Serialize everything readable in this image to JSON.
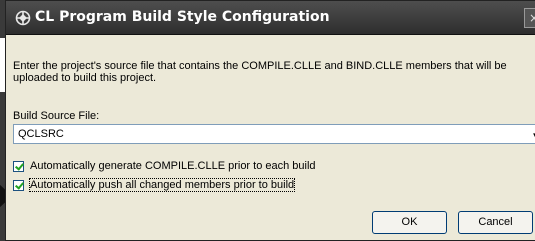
{
  "dialog": {
    "title": "CL Program Build Style Configuration",
    "description": "Enter the project's source file that contains the COMPILE.CLLE and BIND.CLLE members that will be uploaded to build this project.",
    "build_source_label": "Build Source File:",
    "build_source_value": "QCLSRC",
    "checkbox_generate": {
      "label": "Automatically generate COMPILE.CLLE prior to each build",
      "checked": true
    },
    "checkbox_push": {
      "label": "Automatically push all changed members prior to build",
      "checked": true
    },
    "ok_label": "OK",
    "cancel_label": "Cancel",
    "close_glyph": "×"
  },
  "colors": {
    "titlebar": "#3a3a3a",
    "dialog_bg": "#ece9d8",
    "check_mark": "#21a121"
  }
}
